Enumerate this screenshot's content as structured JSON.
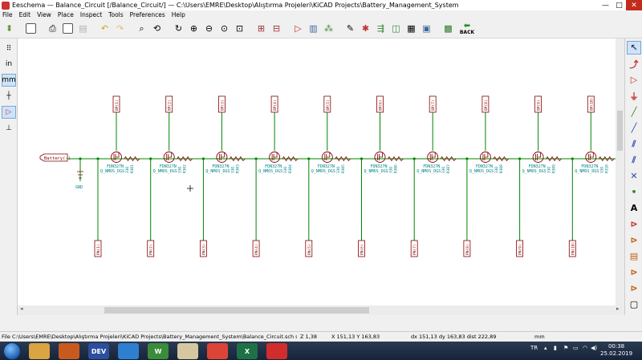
{
  "window": {
    "title": "Eeschema — Balance_Circuit [/Balance_Circuit/] — C:\\Users\\EMRE\\Desktop\\Alıştırma Projeleri\\KiCAD Projects\\Battery_Management_System",
    "controls": {
      "minimize": "—",
      "maximize": "□",
      "close": "✕"
    }
  },
  "menu": [
    "File",
    "Edit",
    "View",
    "Place",
    "Inspect",
    "Tools",
    "Preferences",
    "Help"
  ],
  "toolbar": {
    "back_label": "BACK"
  },
  "left_toolbar": {
    "units_in": "in",
    "units_mm": "mm"
  },
  "right_toolbar": {
    "label_a": "A"
  },
  "schematic": {
    "battery_label": "Battery(-)",
    "gnd_label": "GND",
    "transistor_part": "FDN327N",
    "transistor_type": "Q_NMOS_DGS",
    "resistor_value": "33Ω",
    "units": [
      {
        "top": "BP(1)",
        "bottom": "PN(1)",
        "ref": "R301"
      },
      {
        "top": "BP(2)",
        "bottom": "PN(2)",
        "ref": "R302"
      },
      {
        "top": "BP(3)",
        "bottom": "PN(3)",
        "ref": "R303"
      },
      {
        "top": "BP(4)",
        "bottom": "PN(4)",
        "ref": "R304"
      },
      {
        "top": "BP(5)",
        "bottom": "PN(5)",
        "ref": "R305"
      },
      {
        "top": "BP(6)",
        "bottom": "PN(6)",
        "ref": "R306"
      },
      {
        "top": "BP(7)",
        "bottom": "PN(7)",
        "ref": "R307"
      },
      {
        "top": "BP(8)",
        "bottom": "PN(8)",
        "ref": "R308"
      },
      {
        "top": "BP(9)",
        "bottom": "PN(9)",
        "ref": "R309"
      },
      {
        "top": "BP(10)",
        "bottom": "PN(10)",
        "ref": "R310"
      }
    ],
    "colors": {
      "wire": "#008400",
      "component": "#840000",
      "label": "#840000",
      "text": "#008484",
      "junction": "#008400"
    }
  },
  "statusbar": {
    "file": "File C:\\Users\\EMRE\\Desktop\\Alıştırma Projeleri\\KiCAD Projects\\Battery_Management_System\\Balance_Circuit.sch sa...",
    "zoom": "Z 1,38",
    "xy": "X 151,13  Y 163,83",
    "delta": "dx 151,13  dy 163,83  dist 222,89",
    "units": "mm"
  },
  "taskbar": {
    "apps": [
      {
        "name": "explorer",
        "label": "",
        "color": "#d9a441"
      },
      {
        "name": "matlab",
        "label": "",
        "color": "#c85a1e"
      },
      {
        "name": "devcpp",
        "label": "DEV",
        "color": "#2b4f9e"
      },
      {
        "name": "virtualbox",
        "label": "",
        "color": "#2f7fd0"
      },
      {
        "name": "winscp",
        "label": "W",
        "color": "#3a8c3a"
      },
      {
        "name": "kicad",
        "label": "",
        "color": "#d5c7a0"
      },
      {
        "name": "chrome",
        "label": "",
        "color": "#db4437"
      },
      {
        "name": "excel",
        "label": "X",
        "color": "#1e7145"
      },
      {
        "name": "acrobat",
        "label": "",
        "color": "#d22d2d"
      }
    ],
    "language": "TR",
    "time": "00:38",
    "date": "25.02.2019"
  }
}
